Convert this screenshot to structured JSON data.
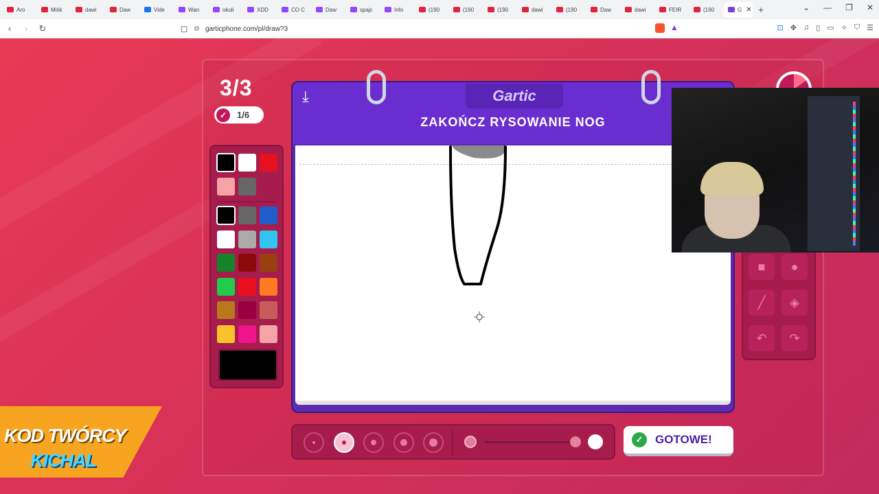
{
  "browser": {
    "tabs": [
      {
        "title": "Aro",
        "color": "#e0243b"
      },
      {
        "title": "Miśk",
        "color": "#e0243b"
      },
      {
        "title": "dawi",
        "color": "#e0243b"
      },
      {
        "title": "Daw",
        "color": "#e0243b"
      },
      {
        "title": "Vide",
        "color": "#1a73e8"
      },
      {
        "title": "Wan",
        "color": "#9146ff"
      },
      {
        "title": "okuli",
        "color": "#9146ff"
      },
      {
        "title": "XDD",
        "color": "#9146ff"
      },
      {
        "title": "CO C",
        "color": "#9146ff"
      },
      {
        "title": "Daw",
        "color": "#9146ff"
      },
      {
        "title": "spajc",
        "color": "#9146ff"
      },
      {
        "title": "Info",
        "color": "#9146ff"
      },
      {
        "title": "(190",
        "color": "#e0243b"
      },
      {
        "title": "(190",
        "color": "#e0243b"
      },
      {
        "title": "(190",
        "color": "#e0243b"
      },
      {
        "title": "dawi",
        "color": "#e0243b"
      },
      {
        "title": "(190",
        "color": "#e0243b"
      },
      {
        "title": "Daw",
        "color": "#e0243b"
      },
      {
        "title": "dawi",
        "color": "#e0243b"
      },
      {
        "title": "FEIR",
        "color": "#e0243b"
      },
      {
        "title": "(190",
        "color": "#e0243b"
      }
    ],
    "active_tab": "G",
    "new_tab_icon": "plus-icon",
    "url": "garticphone.com/pl/draw?3",
    "window_controls": [
      "chevron-down-icon",
      "minimize-icon",
      "restore-icon",
      "close-icon"
    ]
  },
  "game": {
    "round": "3/3",
    "progress": "1/6",
    "logo": "Gartic",
    "prompt": "ZAKOŃCZ RYSOWANIE NOG",
    "done_label": "GOTOWE!",
    "palette_top": [
      "#000000",
      "#ffffff",
      "#e8101e",
      "#f5a3a6",
      "#666666"
    ],
    "palette_main": [
      "#000000",
      "#666666",
      "#1f5ccc",
      "#ffffff",
      "#aaaaaa",
      "#33c4f2",
      "#15832a",
      "#8a0a0a",
      "#98400f",
      "#22c94a",
      "#e8101e",
      "#ff7a22",
      "#b8781b",
      "#9a0040",
      "#c65b5b",
      "#f8c32a",
      "#f0148b",
      "#f5a3a6"
    ],
    "current_color": "#000000",
    "brush_sizes": [
      1,
      2,
      3,
      4,
      5
    ],
    "selected_brush": 2,
    "opacity": 1.0,
    "tools": [
      "square-icon",
      "circle-icon",
      "line-icon",
      "bucket-icon",
      "undo-icon",
      "redo-icon"
    ]
  },
  "overlay": {
    "promo_line1": "KOD TWÓRCY",
    "promo_line2": "KICHAL"
  }
}
